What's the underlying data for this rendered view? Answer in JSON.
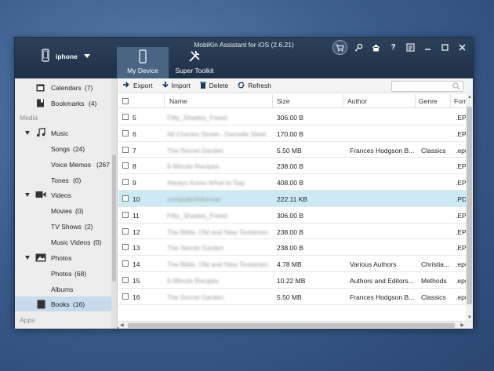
{
  "app_title": "MobiKin Assistant for iOS (2.6.21)",
  "device": {
    "name": "iphone"
  },
  "tabs": [
    {
      "label": "My Device",
      "icon": "phone-icon",
      "active": true
    },
    {
      "label": "Super Toolkit",
      "icon": "tools-icon",
      "active": false
    }
  ],
  "window_controls": [
    "cart-icon",
    "key-icon",
    "home-icon",
    "help-icon",
    "register-icon",
    "minimize-icon",
    "maximize-icon",
    "close-icon"
  ],
  "help_label": "?",
  "sidebar": {
    "calendars": {
      "label": "Calendars",
      "count": "(7)"
    },
    "bookmarks": {
      "label": "Bookmarks",
      "count": "(4)"
    },
    "media_section": "Media",
    "music": {
      "label": "Music"
    },
    "songs": {
      "label": "Songs",
      "count": "(24)"
    },
    "voice_memos": {
      "label": "Voice Memos",
      "count": "(267"
    },
    "tones": {
      "label": "Tones",
      "count": "(0)"
    },
    "videos": {
      "label": "Videos"
    },
    "movies": {
      "label": "Movies",
      "count": "(0)"
    },
    "tv_shows": {
      "label": "TV Shows",
      "count": "(2)"
    },
    "music_videos": {
      "label": "Music Videos",
      "count": "(0)"
    },
    "photos": {
      "label": "Photos"
    },
    "photos_sub": {
      "label": "Photos",
      "count": "(68)"
    },
    "albums": {
      "label": "Albums"
    },
    "books": {
      "label": "Books",
      "count": "(16)"
    },
    "apps_section": "Apps"
  },
  "toolbar": {
    "export": "Export",
    "import": "Import",
    "delete": "Delete",
    "refresh": "Refresh",
    "search_placeholder": ""
  },
  "columns": {
    "name": "Name",
    "size": "Size",
    "author": "Author",
    "genre": "Genre",
    "format": "Format"
  },
  "rows": [
    {
      "num": "5",
      "name": "Fifty_Shades_Freed",
      "size": "306.00 B",
      "author": "",
      "genre": "",
      "format": ".EPUB",
      "blur": true
    },
    {
      "num": "6",
      "name": "All Charles Street - Danielle Steel",
      "size": "170.00 B",
      "author": "",
      "genre": "",
      "format": ".EPUB",
      "blur": true
    },
    {
      "num": "7",
      "name": "The Secret Garden",
      "size": "5.50 MB",
      "author": "Frances Hodgson B...",
      "genre": "Classics",
      "format": ".epub",
      "blur": true
    },
    {
      "num": "8",
      "name": "5-Minute Recipes",
      "size": "238.00 B",
      "author": "",
      "genre": "",
      "format": ".EPUB",
      "blur": true
    },
    {
      "num": "9",
      "name": "Always Know What to Say",
      "size": "408.00 B",
      "author": "",
      "genre": "",
      "format": ".EPUB",
      "blur": true
    },
    {
      "num": "10",
      "name": "computerifsformat",
      "size": "222.11 KB",
      "author": "",
      "genre": "",
      "format": ".PDF",
      "blur": true,
      "selected": true
    },
    {
      "num": "11",
      "name": "Fifty_Shades_Freed",
      "size": "306.00 B",
      "author": "",
      "genre": "",
      "format": ".EPUB",
      "blur": true
    },
    {
      "num": "12",
      "name": "The Bible, Old and New Testamen...",
      "size": "238.00 B",
      "author": "",
      "genre": "",
      "format": ".EPUB",
      "blur": true
    },
    {
      "num": "13",
      "name": "The Secret Garden",
      "size": "238.00 B",
      "author": "",
      "genre": "",
      "format": ".EPUB",
      "blur": true
    },
    {
      "num": "14",
      "name": "The Bible, Old and New Testamen...",
      "size": "4.78 MB",
      "author": "Various Authors",
      "genre": "Christia...",
      "format": ".epub",
      "blur": true
    },
    {
      "num": "15",
      "name": "5-Minute Recipes",
      "size": "10.22 MB",
      "author": "Authors and Editors...",
      "genre": "Methods",
      "format": ".epub",
      "blur": true
    },
    {
      "num": "16",
      "name": "The Secret Garden",
      "size": "5.50 MB",
      "author": "Frances Hodgson B...",
      "genre": "Classics",
      "format": ".epub",
      "blur": true
    }
  ],
  "colors": {
    "titlebar": "#1e3046",
    "tab_active": "#4b6483",
    "selected_row": "#cde9f4",
    "sidebar_selected": "#c7dbed"
  }
}
